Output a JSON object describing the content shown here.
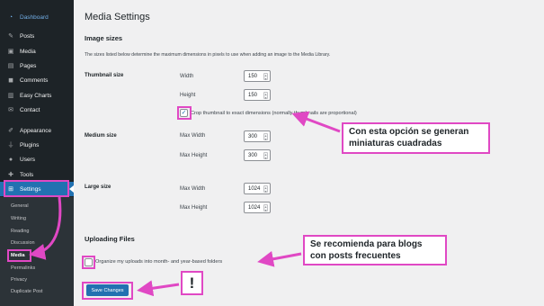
{
  "sidebar": {
    "items": [
      {
        "label": "Dashboard",
        "icon": "dashboard-icon"
      },
      {
        "label": "Posts",
        "icon": "pin-icon"
      },
      {
        "label": "Media",
        "icon": "media-icon"
      },
      {
        "label": "Pages",
        "icon": "pages-icon"
      },
      {
        "label": "Comments",
        "icon": "comment-icon"
      },
      {
        "label": "Easy Charts",
        "icon": "chart-icon"
      },
      {
        "label": "Contact",
        "icon": "mail-icon"
      },
      {
        "label": "Appearance",
        "icon": "brush-icon"
      },
      {
        "label": "Plugins",
        "icon": "plugin-icon"
      },
      {
        "label": "Users",
        "icon": "user-icon"
      },
      {
        "label": "Tools",
        "icon": "wrench-icon"
      },
      {
        "label": "Settings",
        "icon": "settings-icon"
      }
    ],
    "submenu": [
      "General",
      "Writing",
      "Reading",
      "Discussion",
      "Media",
      "Permalinks",
      "Privacy",
      "Duplicate Post"
    ]
  },
  "page": {
    "title": "Media Settings",
    "image_sizes_heading": "Image sizes",
    "image_sizes_desc": "The sizes listed below determine the maximum dimensions in pixels to use when adding an image to the Media Library.",
    "thumbnail": {
      "label": "Thumbnail size",
      "width_label": "Width",
      "width_value": "150",
      "height_label": "Height",
      "height_value": "150",
      "crop_label": "Crop thumbnail to exact dimensions (normally thumbnails are proportional)"
    },
    "medium": {
      "label": "Medium size",
      "max_width_label": "Max Width",
      "max_width_value": "300",
      "max_height_label": "Max Height",
      "max_height_value": "300"
    },
    "large": {
      "label": "Large size",
      "max_width_label": "Max Width",
      "max_width_value": "1024",
      "max_height_label": "Max Height",
      "max_height_value": "1024"
    },
    "uploading_heading": "Uploading Files",
    "organize_label": "Organize my uploads into month- and year-based folders",
    "save_label": "Save Changes"
  },
  "annotations": {
    "crop_note": "Con esta opción se generan\nminiaturas cuadradas",
    "folders_note": "Se recomienda para blogs\ncon posts frecuentes",
    "exclamation": "!"
  },
  "colors": {
    "sidebar_bg": "#1d2327",
    "active_blue": "#2271b1",
    "highlight_pink": "#e048c4"
  }
}
